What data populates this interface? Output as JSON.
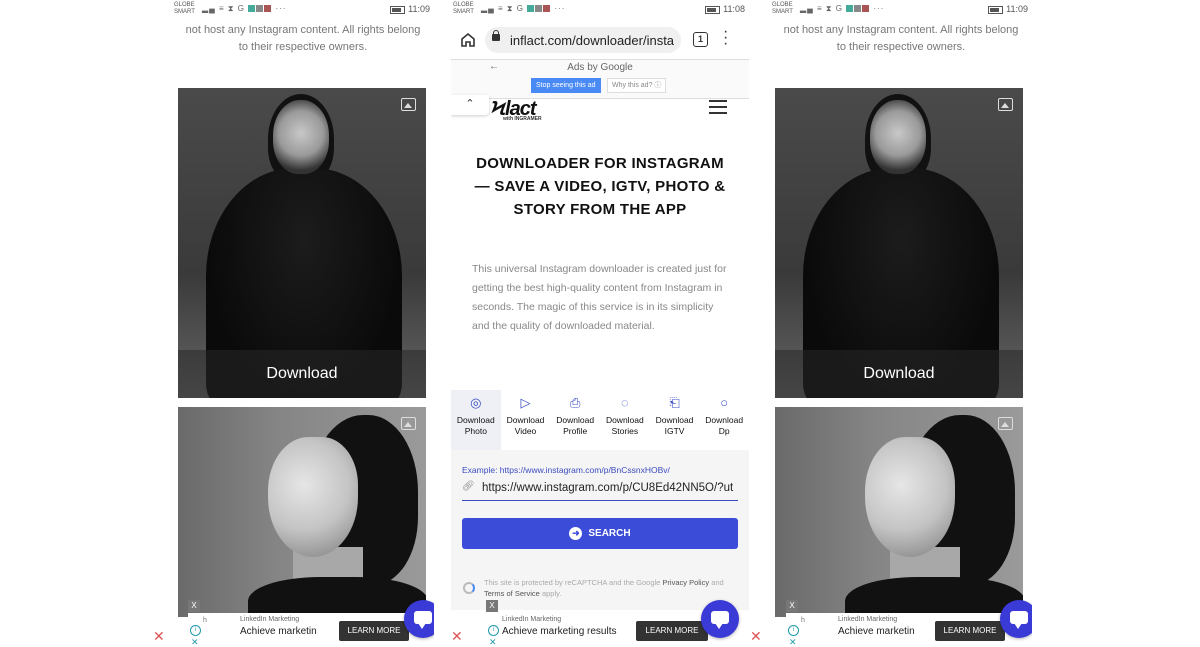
{
  "status_bar": {
    "carrier_top": "GLOBE",
    "carrier_bottom": "SMART",
    "icons": "▂▄ ≡ ⧗ G",
    "more": "···",
    "time_left": "11:09",
    "time_middle": "11:08",
    "time_right": "11:09"
  },
  "notice": {
    "line1": "not host any Instagram content. All rights belong",
    "line2": "to their respective owners."
  },
  "gallery": {
    "download_label": "Download"
  },
  "browser": {
    "url": "inflact.com/downloader/insta",
    "tab_count": "1"
  },
  "ads_by": {
    "back": "←",
    "label": "Ads by Google",
    "stop": "Stop seeing this ad",
    "why": "Why this ad? ⓘ"
  },
  "site": {
    "logo": "Ϟlact",
    "logo_sub": "with INGRAMER",
    "collapse": "⌃",
    "headline": "DOWNLOADER FOR INSTAGRAM — SAVE A VIDEO, IGTV, PHOTO & STORY FROM THE APP",
    "description": "This universal Instagram downloader is created just for getting the best high-quality content from Instagram in seconds. The magic of this service is in its simplicity and the quality of downloaded material."
  },
  "tabs": [
    {
      "line1": "Download",
      "line2": "Photo",
      "icon": "camera-icon",
      "glyph": "◎"
    },
    {
      "line1": "Download",
      "line2": "Video",
      "icon": "play-icon",
      "glyph": "▷"
    },
    {
      "line1": "Download",
      "line2": "Profile",
      "icon": "profile-icon",
      "glyph": "⎙"
    },
    {
      "line1": "Download",
      "line2": "Stories",
      "icon": "stories-icon",
      "glyph": "◌"
    },
    {
      "line1": "Download",
      "line2": "IGTV",
      "icon": "tv-icon",
      "glyph": "⎗"
    },
    {
      "line1": "Download",
      "line2": "Dp",
      "icon": "person-icon",
      "glyph": "○"
    }
  ],
  "form": {
    "example": "Example: https://www.instagram.com/p/BnCssnxHOBv/",
    "value": "https://www.instagram.com/p/CU8Ed42NN5O/?ut",
    "search_label": "SEARCH",
    "captcha_prefix": "This site is protected by reCAPTCHA and the Google ",
    "privacy": "Privacy Policy",
    "and": " and ",
    "terms": "Terms of Service",
    "apply": " apply."
  },
  "ad": {
    "close": "X",
    "h": "h",
    "title": "LinkedIn Marketing",
    "text_short": "Achieve marketin",
    "text_full": "Achieve marketing results",
    "button": "LEARN MORE",
    "outer_x": "✕"
  }
}
